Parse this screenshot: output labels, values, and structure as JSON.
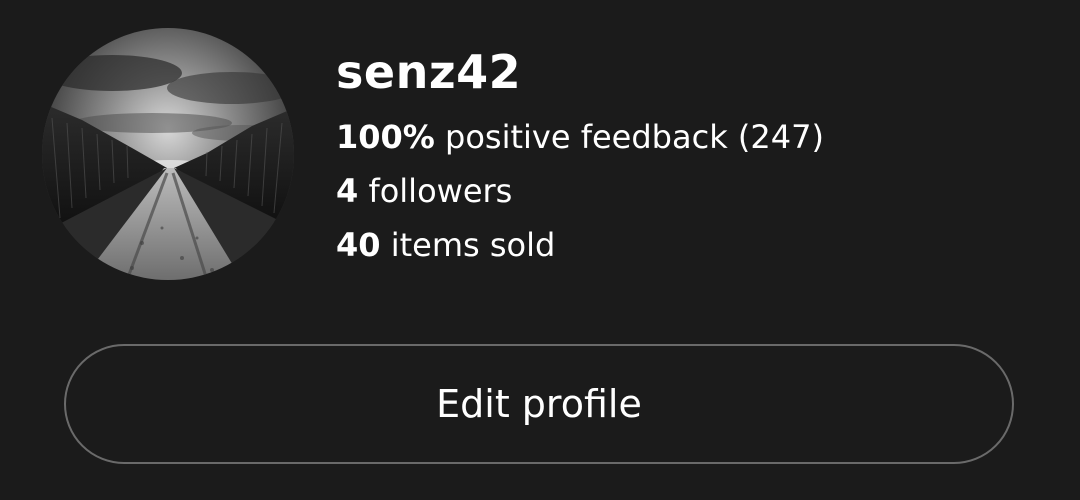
{
  "profile": {
    "username": "senz42",
    "avatar_icon": "profile-photo-dirt-road-cornfield",
    "stats": [
      {
        "value": "100%",
        "label": "positive feedback (247)"
      },
      {
        "value": "4",
        "label": "followers"
      },
      {
        "value": "40",
        "label": "items sold"
      }
    ],
    "edit_button_label": "Edit profile"
  },
  "colors": {
    "background": "#1b1b1b",
    "text": "#ffffff",
    "button_border": "#6a6a6a"
  }
}
